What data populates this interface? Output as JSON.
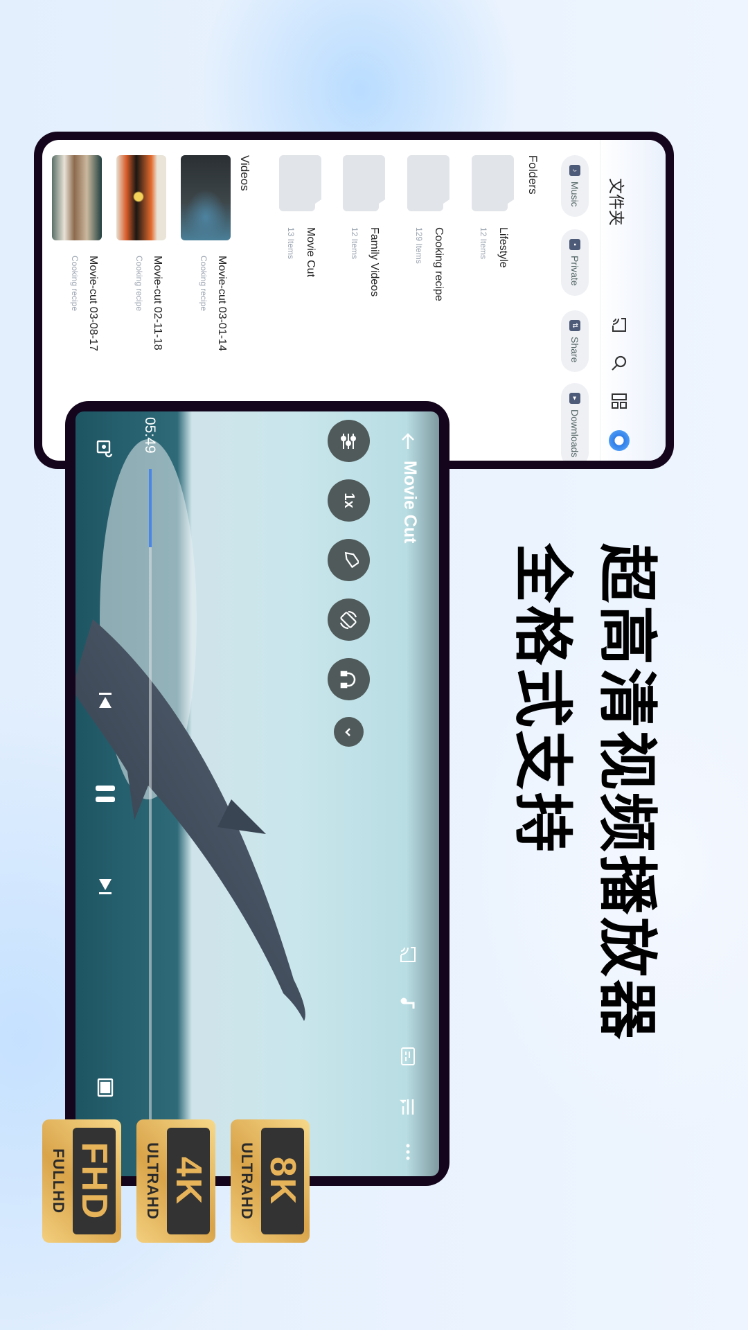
{
  "headline": {
    "line1": "超高清视频播放器",
    "line2": "全格式支持"
  },
  "file_browser": {
    "title": "文件夹",
    "header_icons": [
      "cast-icon",
      "search-icon",
      "grid-view-icon",
      "avatar"
    ],
    "chips": [
      {
        "label": "Music",
        "icon": "music-icon"
      },
      {
        "label": "Private",
        "icon": "lock-icon"
      },
      {
        "label": "Share",
        "icon": "share-icon"
      },
      {
        "label": "Downloads",
        "icon": "download-icon"
      }
    ],
    "folders_label": "Folders",
    "folders": [
      {
        "name": "Lifestyle",
        "count": "12 Items"
      },
      {
        "name": "Cooking recipe",
        "count": "129 Items"
      },
      {
        "name": "Family Videos",
        "count": "12 Items"
      },
      {
        "name": "Movie Cut",
        "count": "13 Items"
      }
    ],
    "videos_label": "Videos",
    "videos": [
      {
        "title": "Movie-cut 03-01-14",
        "folder": "Cooking recipe"
      },
      {
        "title": "Movie-cut 02-11-18",
        "folder": "Cooking recipe"
      },
      {
        "title": "Movie-cut 03-08-17",
        "folder": "Cooking recipe"
      }
    ]
  },
  "player": {
    "title": "Movie Cut",
    "speed_label": "1x",
    "time": "05:49",
    "progress": 0.12,
    "accent": "#4a86e8",
    "top_icons": [
      "cast-icon",
      "music-icon",
      "subtitles-icon",
      "playlist-icon",
      "more-icon"
    ],
    "side_buttons": [
      "equalizer-icon",
      "speed",
      "bookmark-icon",
      "rotate-icon",
      "headphones-icon",
      "chevron-down-icon"
    ],
    "bottom_controls": [
      "lock-icon",
      "previous-icon",
      "pause-icon",
      "next-icon",
      "aspect-ratio-icon"
    ]
  },
  "badges": [
    {
      "big": "8K",
      "small": "ULTRAHD"
    },
    {
      "big": "4K",
      "small": "ULTRAHD"
    },
    {
      "big": "FHD",
      "small": "FULLHD"
    }
  ]
}
